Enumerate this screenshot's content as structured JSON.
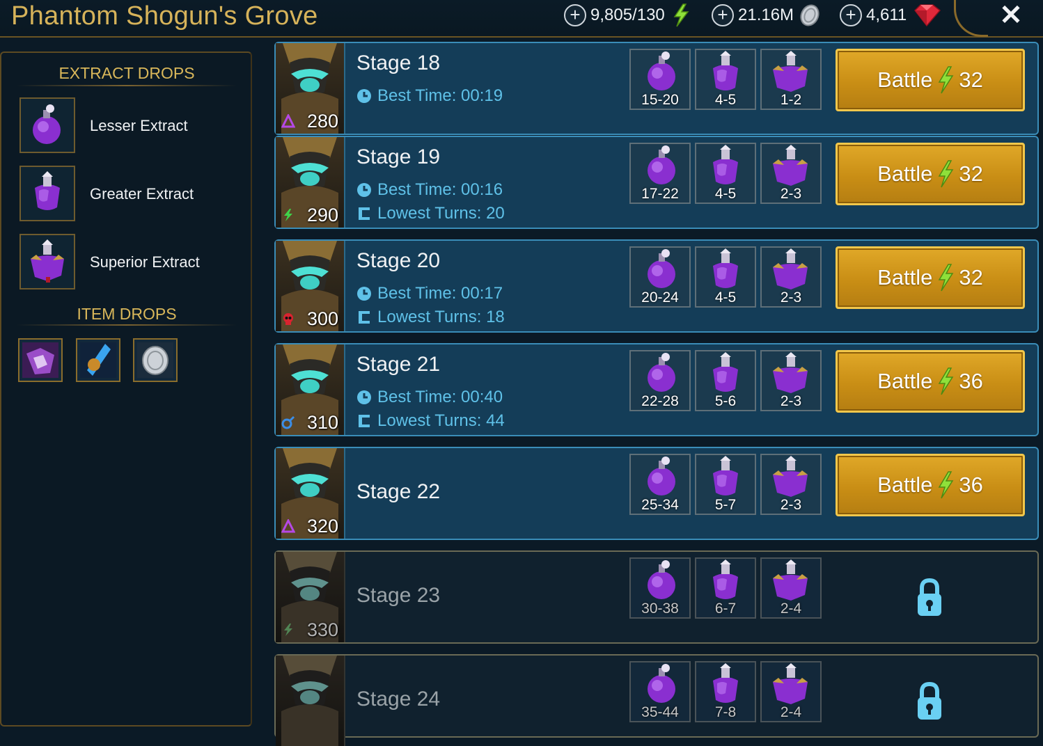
{
  "header": {
    "title": "Phantom Shogun's Grove",
    "energy": "9,805/130",
    "silver": "21.16M",
    "gems": "4,611",
    "energy_icon": "lightning-icon",
    "silver_icon": "silver-coin-icon",
    "gem_icon": "ruby-gem-icon",
    "close_icon": "close-icon"
  },
  "sidebar": {
    "extract_heading": "EXTRACT DROPS",
    "extracts": [
      {
        "name": "Lesser Extract",
        "icon": "lesser-extract-icon"
      },
      {
        "name": "Greater Extract",
        "icon": "greater-extract-icon"
      },
      {
        "name": "Superior Extract",
        "icon": "superior-extract-icon"
      }
    ],
    "item_heading": "ITEM DROPS",
    "items": [
      "artifact-icon",
      "skill-tome-icon",
      "silver-coin-icon"
    ]
  },
  "stages": [
    {
      "name": "Stage 18",
      "level": "280",
      "affinity": "magic",
      "best_time": "Best Time: 00:19",
      "lowest_turns": "",
      "drops": [
        "15-20",
        "4-5",
        "1-2"
      ],
      "battle": "Battle",
      "cost": "32",
      "locked": false
    },
    {
      "name": "Stage 19",
      "level": "290",
      "affinity": "force",
      "best_time": "Best Time: 00:16",
      "lowest_turns": "Lowest Turns: 20",
      "drops": [
        "17-22",
        "4-5",
        "2-3"
      ],
      "battle": "Battle",
      "cost": "32",
      "locked": false
    },
    {
      "name": "Stage 20",
      "level": "300",
      "affinity": "void",
      "best_time": "Best Time: 00:17",
      "lowest_turns": "Lowest Turns: 18",
      "drops": [
        "20-24",
        "4-5",
        "2-3"
      ],
      "battle": "Battle",
      "cost": "32",
      "locked": false
    },
    {
      "name": "Stage 21",
      "level": "310",
      "affinity": "spirit",
      "best_time": "Best Time: 00:40",
      "lowest_turns": "Lowest Turns: 44",
      "drops": [
        "22-28",
        "5-6",
        "2-3"
      ],
      "battle": "Battle",
      "cost": "36",
      "locked": false
    },
    {
      "name": "Stage 22",
      "level": "320",
      "affinity": "magic",
      "best_time": "",
      "lowest_turns": "",
      "drops": [
        "25-34",
        "5-7",
        "2-3"
      ],
      "battle": "Battle",
      "cost": "36",
      "locked": false
    },
    {
      "name": "Stage 23",
      "level": "330",
      "affinity": "force",
      "best_time": "",
      "lowest_turns": "",
      "drops": [
        "30-38",
        "6-7",
        "2-4"
      ],
      "battle": "",
      "cost": "",
      "locked": true
    },
    {
      "name": "Stage 24",
      "level": "",
      "affinity": "",
      "best_time": "",
      "lowest_turns": "",
      "drops": [
        "35-44",
        "7-8",
        "2-4"
      ],
      "battle": "",
      "cost": "",
      "locked": true
    }
  ],
  "colors": {
    "gold": "#d6b35a",
    "accent": "#5fc1e8",
    "battle": "#d39a1e",
    "row_border": "#3a8db8"
  }
}
